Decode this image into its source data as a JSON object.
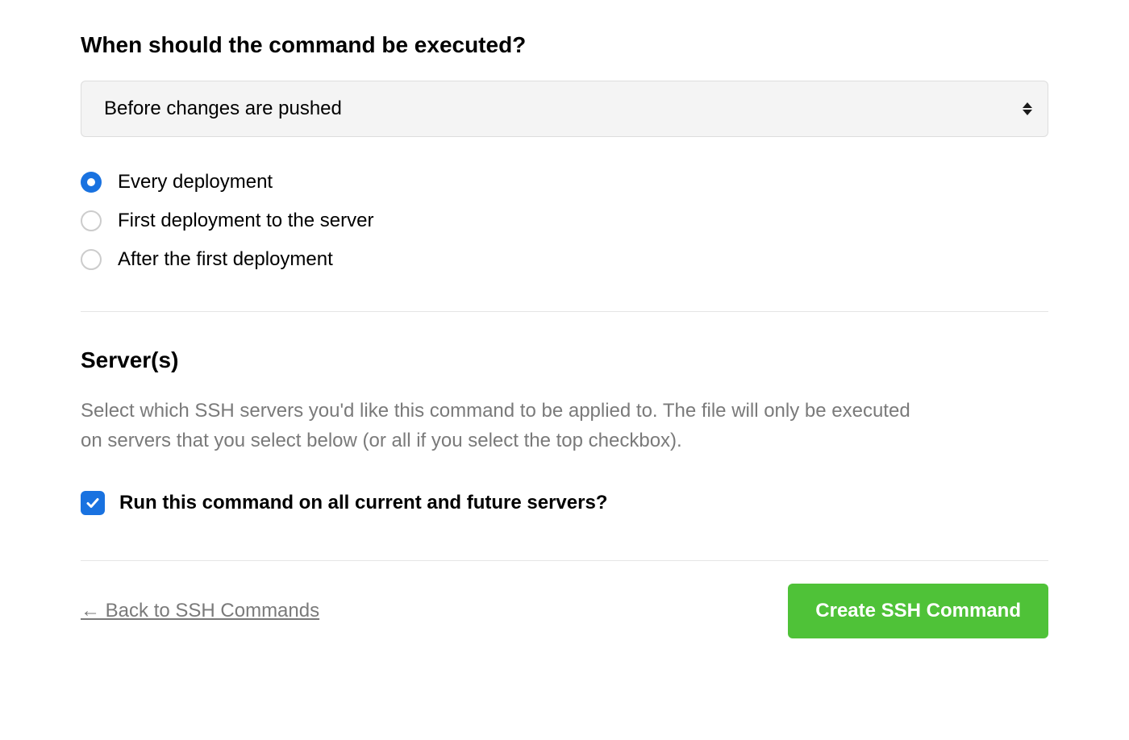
{
  "timing": {
    "heading": "When should the command be executed?",
    "select_value": "Before changes are pushed",
    "options": [
      {
        "label": "Every deployment",
        "selected": true
      },
      {
        "label": "First deployment to the server",
        "selected": false
      },
      {
        "label": "After the first deployment",
        "selected": false
      }
    ]
  },
  "servers": {
    "heading": "Server(s)",
    "description": "Select which SSH servers you'd like this command to be applied to. The file will only be executed on servers that you select below (or all if you select the top checkbox).",
    "checkbox_label": "Run this command on all current and future servers?",
    "checkbox_checked": true
  },
  "footer": {
    "back_link": "← Back to SSH Commands",
    "submit_button": "Create SSH Command"
  }
}
